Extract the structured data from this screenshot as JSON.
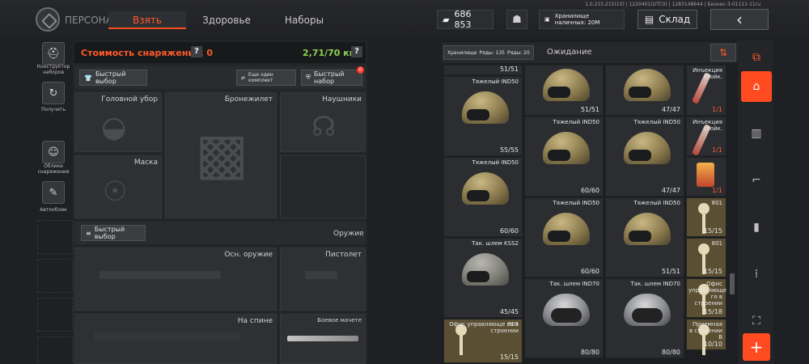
{
  "header": {
    "title": "ПЕРСОНАЖ",
    "tabs": [
      "Взять",
      "Здоровье",
      "Наборы"
    ],
    "version": "1.0.215.215(10) | 1220401(UTC0) | 1283148644 | Бизнес-3-01111-11ru",
    "money": "686 853",
    "cash_storage": "Хранилище наличных: 20M",
    "warehouse": "Склад",
    "back": "‹"
  },
  "sidebar": {
    "items": [
      {
        "label": "Конструктор наборов",
        "icon": "helmet-icon"
      },
      {
        "label": "Получить",
        "icon": "retrieve-icon"
      },
      {
        "label": "Облики снаряжения",
        "icon": "skin-icon"
      },
      {
        "label": "Автооблик",
        "icon": "brush-icon"
      }
    ]
  },
  "equipment": {
    "cost_label": "Стоимость снаряжения: 0",
    "weight": "2,71/70 кг",
    "quick_select": "Быстрый выбор",
    "another_kit": "Еще один комплект",
    "quick_kit": "Быстрый набор",
    "quick_kit_badge": "0",
    "slots": {
      "headgear": "Головной убор",
      "vest": "Бронежилет",
      "headphones": "Наушники",
      "mask": "Маска",
      "weapon_header": "Оружие",
      "quick_select2": "Быстрый выбор",
      "primary": "Осн. оружие",
      "pistol": "Пистолет",
      "back": "На спине",
      "machete": "Боевое мачете"
    }
  },
  "inventory": {
    "tab_storage": "Хранилище",
    "rows_a": "Ряды: 135",
    "rows_b": "Ряды: 20",
    "tab_pending": "Ожидание",
    "columns": [
      [
        {
          "name": "",
          "count": "51/51",
          "kind": "helmet",
          "h": 14
        },
        {
          "name": "Тяжелый IND50",
          "count": "55/55",
          "kind": "helmet",
          "h": 100
        },
        {
          "name": "Тяжелый IND50",
          "count": "60/60",
          "kind": "helmet",
          "h": 100
        },
        {
          "name": "Так. шлем KSS2",
          "count": "45/45",
          "kind": "helmet-gray",
          "h": 100
        },
        {
          "name": "Офис управляюще го в строении",
          "count": "15/15",
          "kind": "key",
          "h": 56,
          "extra": "803"
        }
      ],
      [
        {
          "name": "",
          "count": "51/51",
          "kind": "helmet",
          "h": 64
        },
        {
          "name": "Тяжелый IND50",
          "count": "60/60",
          "kind": "helmet",
          "h": 100
        },
        {
          "name": "Тяжелый IND50",
          "count": "60/60",
          "kind": "helmet",
          "h": 100
        },
        {
          "name": "Так. шлем IND70",
          "count": "80/80",
          "kind": "helmet-chrome",
          "h": 100
        }
      ],
      [
        {
          "name": "",
          "count": "47/47",
          "kind": "helmet",
          "h": 64
        },
        {
          "name": "Тяжелый IND50",
          "count": "47/47",
          "kind": "helmet",
          "h": 100
        },
        {
          "name": "Тяжелый IND50",
          "count": "51/51",
          "kind": "helmet",
          "h": 100
        },
        {
          "name": "Так. шлем IND70",
          "count": "80/80",
          "kind": "helmet-chrome",
          "h": 100
        }
      ],
      [
        {
          "name": "Инъекция стойк.",
          "count": "1/1",
          "kind": "syringe",
          "h": 64,
          "red": true
        },
        {
          "name": "Инъекция стойк.",
          "count": "1/1",
          "kind": "syringe",
          "h": 50,
          "red": true
        },
        {
          "name": "",
          "count": "1/1",
          "kind": "food",
          "h": 50,
          "red": true
        },
        {
          "name": "",
          "count": "15/15",
          "kind": "key",
          "h": 50,
          "extra": "801"
        },
        {
          "name": "",
          "count": "15/15",
          "kind": "key",
          "h": 50,
          "extra": "801"
        },
        {
          "name": "Офис управляюще го в строении",
          "count": "15/18",
          "kind": "key",
          "h": 50
        },
        {
          "name": "Приемная в строении B",
          "count": "10/10",
          "kind": "key",
          "h": 40
        }
      ]
    ]
  },
  "categories": [
    "home-icon",
    "vest-icon",
    "rifle-icon",
    "magazine-icon",
    "ammo-icon",
    "backpack-icon"
  ],
  "add_label": "+"
}
